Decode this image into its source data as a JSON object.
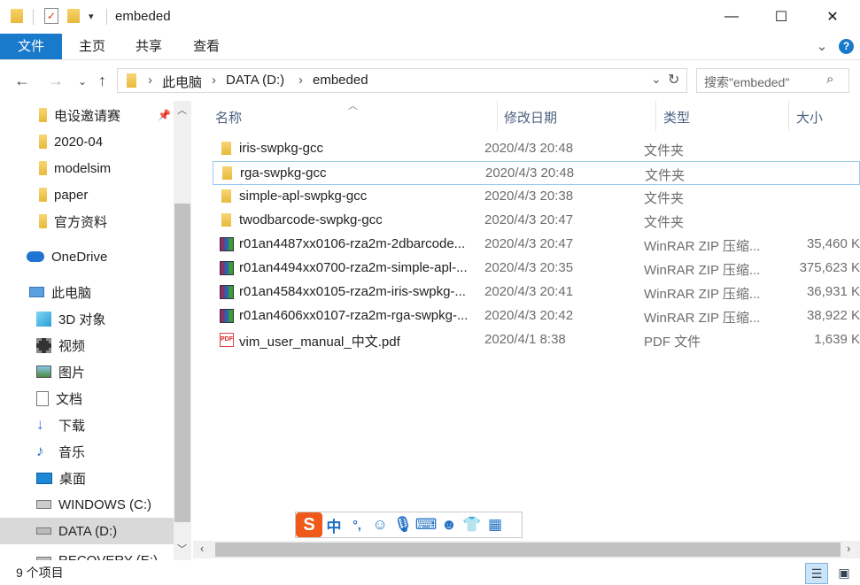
{
  "window": {
    "title": "embeded",
    "minimize": "—",
    "maximize": "☐",
    "close": "✕"
  },
  "ribbon": {
    "tabs": [
      "文件",
      "主页",
      "共享",
      "查看"
    ],
    "expand": "⌄",
    "help": "?"
  },
  "address": {
    "path": [
      "此电脑",
      "DATA (D:)",
      "embeded"
    ],
    "separator": "›"
  },
  "search": {
    "placeholder": "搜索\"embeded\""
  },
  "sidebar": {
    "quick_access": [
      "电设邀请赛",
      "2020-04",
      "modelsim",
      "paper",
      "官方资料"
    ],
    "onedrive": "OneDrive",
    "this_pc": "此电脑",
    "pc_items": [
      {
        "label": "3D 对象",
        "icon": "3d-objects-icon"
      },
      {
        "label": "视频",
        "icon": "video-icon"
      },
      {
        "label": "图片",
        "icon": "pictures-icon"
      },
      {
        "label": "文档",
        "icon": "documents-icon"
      },
      {
        "label": "下载",
        "icon": "downloads-icon"
      },
      {
        "label": "音乐",
        "icon": "music-icon"
      },
      {
        "label": "桌面",
        "icon": "desktop-icon"
      },
      {
        "label": "WINDOWS (C:)",
        "icon": "drive-c-icon"
      },
      {
        "label": "DATA (D:)",
        "icon": "drive-d-icon"
      },
      {
        "label": "RECOVERY (E:)",
        "icon": "drive-e-icon"
      }
    ]
  },
  "columns": [
    "名称",
    "修改日期",
    "类型",
    "大小"
  ],
  "files": [
    {
      "name": "iris-swpkg-gcc",
      "date": "2020/4/3 20:48",
      "type": "文件夹",
      "size": "",
      "icon": "folder"
    },
    {
      "name": "rga-swpkg-gcc",
      "date": "2020/4/3 20:48",
      "type": "文件夹",
      "size": "",
      "icon": "folder"
    },
    {
      "name": "simple-apl-swpkg-gcc",
      "date": "2020/4/3 20:38",
      "type": "文件夹",
      "size": "",
      "icon": "folder"
    },
    {
      "name": "twodbarcode-swpkg-gcc",
      "date": "2020/4/3 20:47",
      "type": "文件夹",
      "size": "",
      "icon": "folder"
    },
    {
      "name": "r01an4487xx0106-rza2m-2dbarcode...",
      "date": "2020/4/3 20:47",
      "type": "WinRAR ZIP 压缩...",
      "size": "35,460 K",
      "icon": "rar"
    },
    {
      "name": "r01an4494xx0700-rza2m-simple-apl-...",
      "date": "2020/4/3 20:35",
      "type": "WinRAR ZIP 压缩...",
      "size": "375,623 K",
      "icon": "rar"
    },
    {
      "name": "r01an4584xx0105-rza2m-iris-swpkg-...",
      "date": "2020/4/3 20:41",
      "type": "WinRAR ZIP 压缩...",
      "size": "36,931 K",
      "icon": "rar"
    },
    {
      "name": "r01an4606xx0107-rza2m-rga-swpkg-...",
      "date": "2020/4/3 20:42",
      "type": "WinRAR ZIP 压缩...",
      "size": "38,922 K",
      "icon": "rar"
    },
    {
      "name": "vim_user_manual_中文.pdf",
      "date": "2020/4/1 8:38",
      "type": "PDF 文件",
      "size": "1,639 K",
      "icon": "pdf"
    }
  ],
  "status": {
    "count": "9 个项目"
  },
  "ime": {
    "logo": "S",
    "mode": "中",
    "punct": "°,"
  },
  "colors": {
    "accent": "#1979ca",
    "selected": "#d9d9d9"
  }
}
